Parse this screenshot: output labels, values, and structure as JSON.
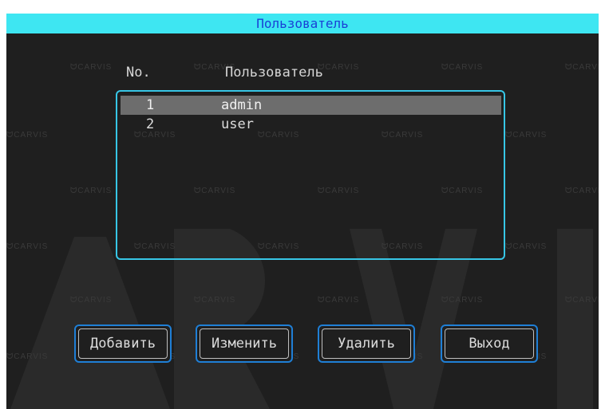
{
  "dialog": {
    "title": "Пользователь"
  },
  "columns": {
    "number": "No.",
    "user": "Пользователь"
  },
  "users": [
    {
      "number": "1",
      "name": "admin",
      "selected": true
    },
    {
      "number": "2",
      "name": "user",
      "selected": false
    }
  ],
  "buttons": {
    "add": "Добавить",
    "edit": "Изменить",
    "delete": "Удалить",
    "exit": "Выход"
  },
  "watermark": {
    "text": "CARVIS"
  },
  "colors": {
    "titlebar": "#3ee6f2",
    "title_text": "#1a3fd6",
    "list_border": "#37c6e6",
    "button_border": "#1f7fd6",
    "selection": "#6d6d6d",
    "background": "#1f1f1f"
  }
}
